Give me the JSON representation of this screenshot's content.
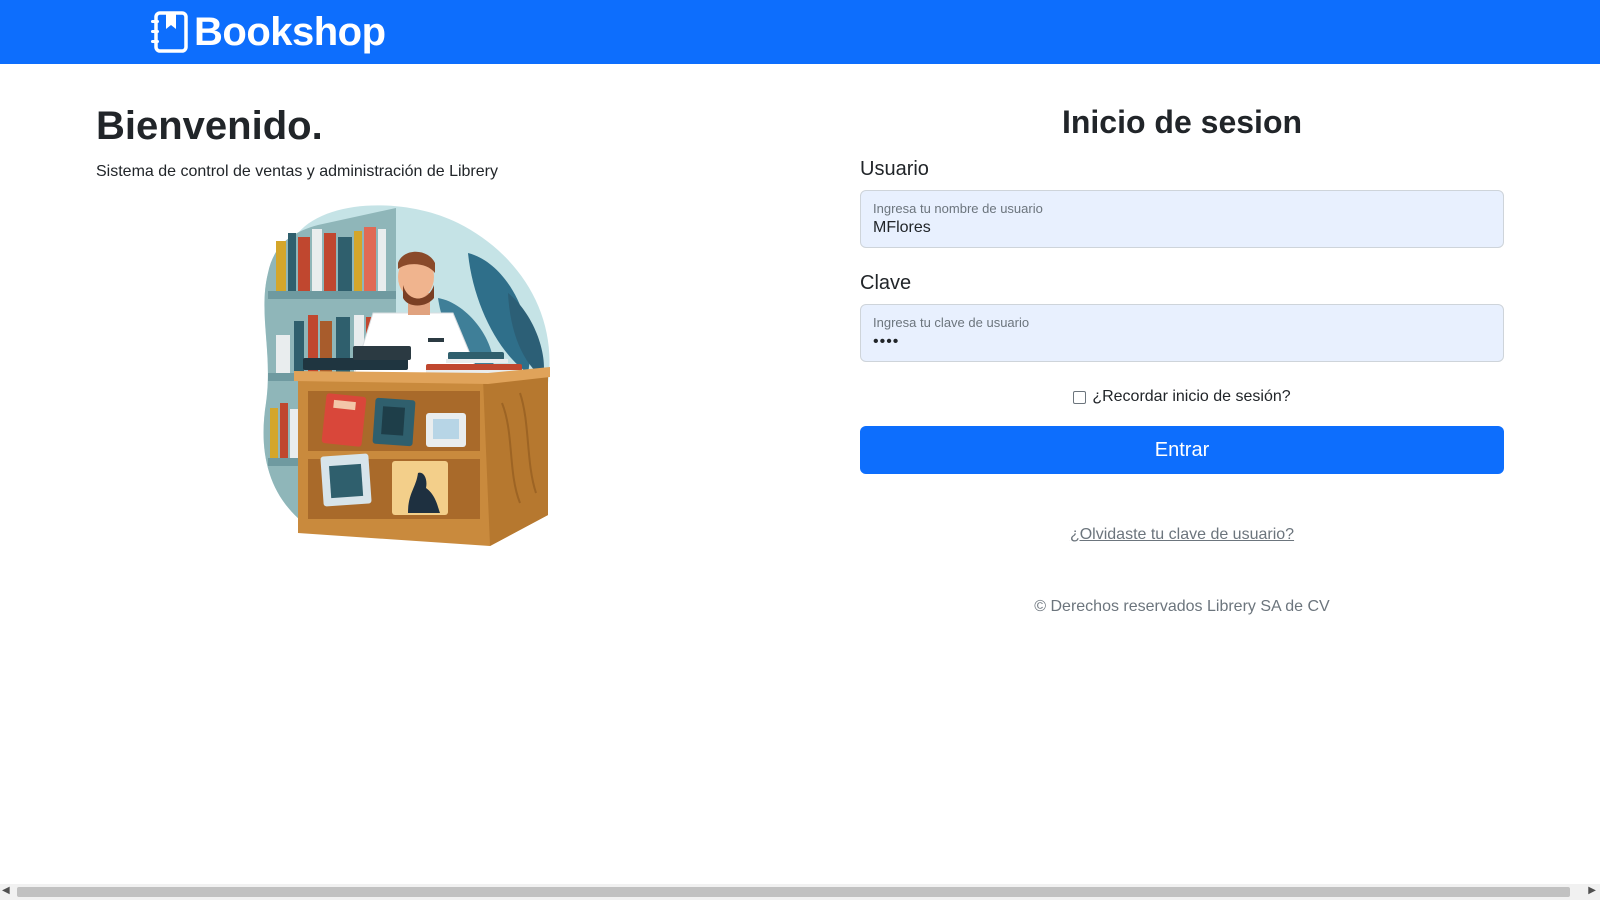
{
  "navbar": {
    "brand": "Bookshop",
    "logo_icon": "notebook-bookmark-icon",
    "color": "#0d6efd"
  },
  "hero": {
    "title": "Bienvenido.",
    "subtitle": "Sistema de control de ventas y administración de Librery",
    "illustration": "bookseller-illustration"
  },
  "login": {
    "title": "Inicio de sesion",
    "username": {
      "label": "Usuario",
      "placeholder": "Ingresa tu nombre de usuario",
      "value": "MFlores"
    },
    "password": {
      "label": "Clave",
      "placeholder": "Ingresa tu clave de usuario",
      "value": "••••"
    },
    "remember": {
      "label": "¿Recordar inicio de sesión?",
      "checked": false
    },
    "submit_label": "Entrar",
    "forgot_label": "¿Olvidaste tu clave de usuario?",
    "copyright": "© Derechos reservados Librery SA de CV"
  },
  "colors": {
    "primary": "#0d6efd",
    "input_bg": "#e8f0fe",
    "muted": "#6c757d"
  }
}
